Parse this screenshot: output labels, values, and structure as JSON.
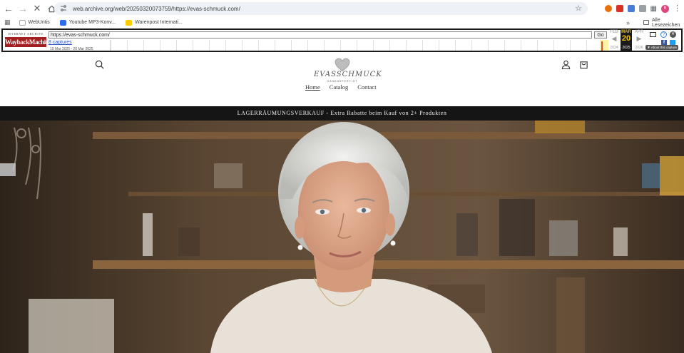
{
  "browser": {
    "url": "web.archive.org/web/20250320073759/https://evas-schmuck.com/",
    "bookmarks": [
      {
        "label": "WebUntis"
      },
      {
        "label": "Youtube MP3-Konv..."
      },
      {
        "label": "Warenpost Internati..."
      }
    ],
    "all_bookmarks_label": "Alle Lesezeichen",
    "profile_initial": "B"
  },
  "wayback": {
    "logo_top": "INTERNET ARCHIVE",
    "logo_main": "WaybackMachine",
    "url_input": "https://evas-schmuck.com/",
    "go_label": "Go",
    "captures": "8 captures",
    "date_range": "19 Mar 2025 - 20 Mar 2025",
    "calendar": {
      "prev_month": "FEB",
      "cur_month": "MAR",
      "next_month": "APR",
      "day": "20",
      "prev_year": "2024",
      "cur_year": "2025",
      "next_year": "2026"
    },
    "about_label": "▼ About this capture"
  },
  "site": {
    "logo_text": "EVASSCHMUCK",
    "logo_sub": "HANDGEFERTIGT",
    "nav": [
      {
        "label": "Home"
      },
      {
        "label": "Catalog"
      },
      {
        "label": "Contact"
      }
    ],
    "announcement": "LAGERRÄUMUNGSVERKAUF - Extra Rabatte beim Kauf von 2+ Produkten"
  },
  "colors": {
    "announcement_bg": "#151515",
    "wayback_accent": "#f0c000",
    "link": "#2550c0"
  }
}
